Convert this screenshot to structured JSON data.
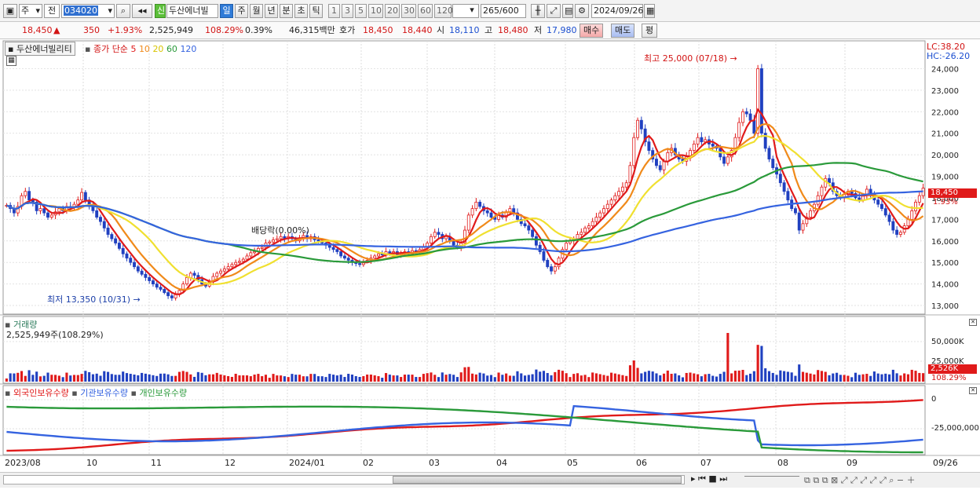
{
  "toolbar": {
    "type_select": "주",
    "mode_select": "전",
    "code": "034020",
    "stock_name": "두산에너빌",
    "credit_badge": "신",
    "periods": [
      "일",
      "주",
      "월",
      "년",
      "분",
      "초",
      "틱"
    ],
    "selected_period": "일",
    "intervals": [
      "1",
      "3",
      "5",
      "10",
      "20",
      "30",
      "60",
      "120"
    ],
    "count_value": "265",
    "count_total": "/600",
    "date": "2024/09/26"
  },
  "quote": {
    "price": "18,450",
    "arrow": "▲",
    "change": "350",
    "change_pct": "+1.93%",
    "volume": "2,525,949",
    "volume_ratio": "108.29%",
    "turnover": "0.39%",
    "amount": "46,315백만",
    "bid_label": "호가",
    "ask": "18,450",
    "bid": "18,440",
    "open_label": "시",
    "open": "18,110",
    "high_label": "고",
    "high": "18,480",
    "low_label": "저",
    "low": "17,980",
    "buy_button": "매수",
    "sell_button": "매도",
    "eval_button": "평"
  },
  "price_panel": {
    "stock_tag": "두산에너빌리티",
    "ma_title": "종가 단순",
    "ma_periods": [
      "5",
      "10",
      "20",
      "60",
      "120"
    ],
    "lc": "LC:38.20",
    "hc": "HC:-26.20",
    "high_annotation": "최고 25,000 (07/18)",
    "low_annotation": "최저 13,350 (10/31)",
    "dividend_annotation": "배당락(0.00%)",
    "current_price_tag": "18,450",
    "current_pct_tag": "1.93%",
    "y_ticks": [
      "24,000",
      "23,000",
      "22,000",
      "21,000",
      "20,000",
      "19,000",
      "18,000",
      "17,000",
      "16,000",
      "15,000",
      "14,000",
      "13,000"
    ]
  },
  "volume_panel": {
    "title": "거래량",
    "value_line": "2,525,949주(108.29%)",
    "y_ticks": [
      "50,000K",
      "25,000K"
    ],
    "current_tag": "2,526K",
    "current_pct": "108.29%"
  },
  "holding_panel": {
    "foreign": "외국인보유수량",
    "institution": "기관보유수량",
    "individual": "개인보유수량",
    "y_ticks": [
      "0",
      "-25,000,000"
    ]
  },
  "x_axis": [
    "2023/08",
    "10",
    "11",
    "12",
    "2024/01",
    "02",
    "03",
    "04",
    "05",
    "06",
    "07",
    "08",
    "09",
    "09/26"
  ],
  "colors": {
    "ma5": "#e01a1a",
    "ma10": "#f08a1a",
    "ma20": "#f0e030",
    "ma60": "#2a9a3a",
    "ma120": "#3563e0",
    "up": "#e01a1a",
    "down": "#2040c0"
  },
  "chart_data": {
    "type": "line",
    "ylim": [
      12600,
      25000
    ],
    "closes": [
      17650,
      17500,
      17300,
      17600,
      18100,
      18300,
      17900,
      17800,
      17400,
      17500,
      17300,
      17100,
      17200,
      17350,
      17500,
      17400,
      17600,
      17550,
      17700,
      17900,
      18250,
      17900,
      17600,
      17400,
      17100,
      16900,
      16600,
      16300,
      16100,
      15900,
      15650,
      15400,
      15200,
      15000,
      14800,
      14600,
      14450,
      14300,
      14150,
      14000,
      13850,
      13750,
      13600,
      13450,
      13350,
      13500,
      13700,
      14000,
      14300,
      14500,
      14400,
      14200,
      14000,
      13900,
      14100,
      14350,
      14500,
      14600,
      14700,
      14800,
      14900,
      15000,
      15050,
      15150,
      15300,
      15450,
      15500,
      15650,
      15700,
      15900,
      15950,
      16050,
      16100,
      16200,
      16100,
      16200,
      16100,
      16000,
      16150,
      16250,
      16100,
      16200,
      16050,
      16000,
      15900,
      15800,
      15700,
      15600,
      15500,
      15300,
      15200,
      15100,
      15000,
      14950,
      14900,
      15050,
      15100,
      15200,
      15300,
      15400,
      15350,
      15500,
      15400,
      15500,
      15350,
      15450,
      15500,
      15400,
      15550,
      15500,
      15600,
      15700,
      15900,
      16200,
      16400,
      16300,
      16100,
      16200,
      16000,
      15800,
      15700,
      15900,
      16500,
      17200,
      17500,
      17800,
      17600,
      17400,
      17300,
      17100,
      17000,
      17200,
      17100,
      17350,
      17500,
      17300,
      17000,
      16800,
      16700,
      16500,
      16200,
      15800,
      15500,
      15100,
      14800,
      14600,
      14800,
      15200,
      15600,
      15900,
      16000,
      16100,
      16300,
      16400,
      16600,
      16700,
      16900,
      17100,
      17300,
      17500,
      17700,
      17900,
      18100,
      18300,
      18500,
      18700,
      19500,
      20800,
      21600,
      21200,
      20600,
      20200,
      19800,
      19500,
      19300,
      19700,
      20100,
      20300,
      20000,
      19800,
      19700,
      19900,
      20200,
      20500,
      20800,
      20600,
      20700,
      20500,
      20400,
      20300,
      19900,
      19600,
      19900,
      20200,
      20800,
      21500,
      22000,
      21900,
      21600,
      21000,
      24000,
      21000,
      20300,
      19800,
      19400,
      19100,
      18700,
      18300,
      17900,
      17500,
      17300,
      16500,
      16800,
      17100,
      17400,
      17700,
      18100,
      18500,
      18900,
      18700,
      18300,
      18100,
      18000,
      18150,
      18300,
      18200,
      18000,
      17900,
      18100,
      18400,
      18200,
      17900,
      17700,
      17500,
      17200,
      16900,
      16500,
      16300,
      16400,
      16700,
      17000,
      17400,
      17800,
      18100,
      18450
    ]
  }
}
